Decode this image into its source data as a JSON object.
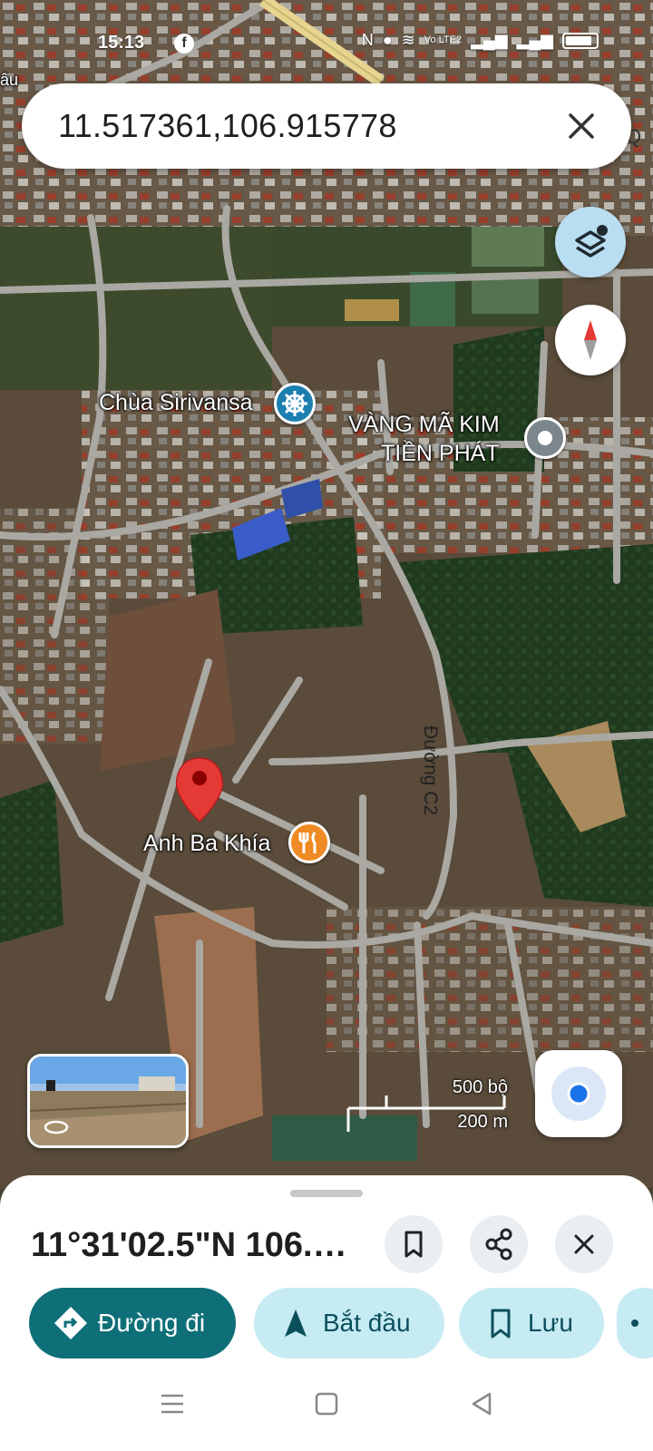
{
  "status_bar": {
    "time": "15:13",
    "network": "Vo LTE2"
  },
  "search": {
    "query": "11.517361,106.915778"
  },
  "map": {
    "labels": {
      "pagoda": "Chùa Sirivansa",
      "shop_line1": "VÀNG MÃ KIM",
      "shop_line2": "TIỀN PHÁT",
      "restaurant": "Anh Ba Khía",
      "road": "Đường C2",
      "top_edge_right": "Q",
      "top_edge_left": "âu"
    },
    "scale": {
      "imperial": "500 bộ",
      "metric": "200 m"
    },
    "pin_color": "#e53935"
  },
  "sheet": {
    "coords_dms": "11°31'02.5\"N 106.915778...",
    "buttons": {
      "directions": "Đường đi",
      "start": "Bắt đầu",
      "save": "Lưu"
    }
  },
  "colors": {
    "primary": "#0e6f78",
    "tonal": "#c6ebf3",
    "location_dot": "#1a73e8"
  }
}
